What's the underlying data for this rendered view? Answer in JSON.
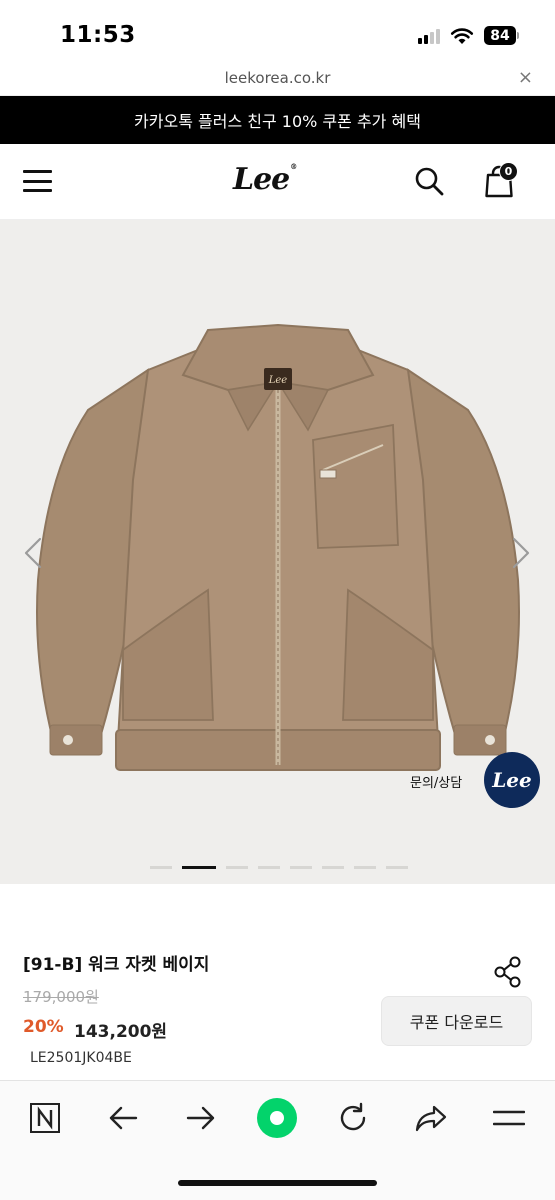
{
  "status_bar": {
    "time": "11:53",
    "battery": "84"
  },
  "url_bar": {
    "url": "leekorea.co.kr",
    "close_icon": "×"
  },
  "promo_banner": {
    "text": "카카오톡 플러스 친구 10% 쿠폰 추가 혜택"
  },
  "header": {
    "logo": "Lee",
    "cart_count": "0",
    "icons": [
      "hamburger-menu-icon",
      "search-icon",
      "cart-icon"
    ]
  },
  "gallery": {
    "chat_label": "문의/상담",
    "chat_button_text": "Lee",
    "slide_count": 8,
    "active_slide": 2,
    "icons": [
      "chevron-left-icon",
      "chevron-right-icon"
    ]
  },
  "product": {
    "name": "[91-B] 워크 자켓 베이지",
    "original_price": "179,000원",
    "discount_rate": "20%",
    "sale_price": "143,200원",
    "code": "LE2501JK04BE",
    "coupon_button": "쿠폰 다운로드",
    "icons": [
      "share-icon"
    ]
  },
  "browser_toolbar": {
    "icons": [
      "naver-n-icon",
      "back-arrow-icon",
      "forward-arrow-icon",
      "green-dot-icon",
      "reload-icon",
      "share-arrow-icon",
      "menu-lines-icon"
    ],
    "accent_color": "#03d36b"
  },
  "colors": {
    "banner_bg": "#000000",
    "discount": "#e05a2a",
    "chat_button_bg": "#0e2a5a",
    "jacket": "#a68b70"
  }
}
